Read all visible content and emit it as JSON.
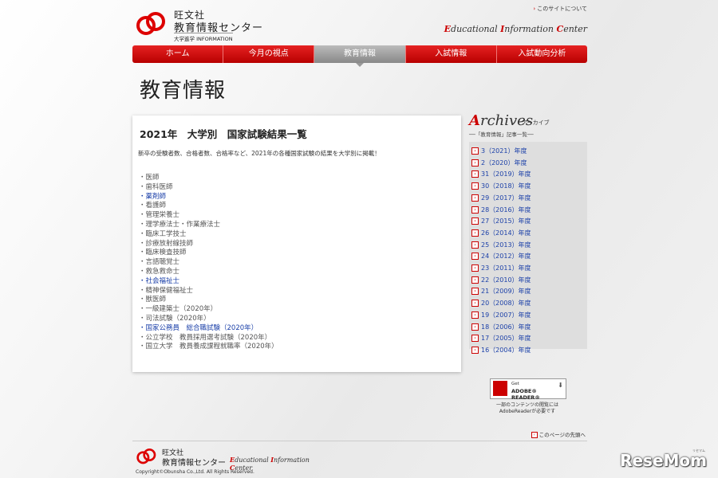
{
  "header": {
    "logo_line1": "旺文社",
    "logo_line2": "教育情報センター",
    "logo_line3": "大学進学 INFORMATION",
    "about_link": "このサイトについて",
    "eic_E": "E",
    "eic_ducational": "ducational ",
    "eic_I": "I",
    "eic_nformation": "nformation ",
    "eic_C": "C",
    "eic_enter": "enter"
  },
  "nav": [
    {
      "label": "ホーム"
    },
    {
      "label": "今月の視点"
    },
    {
      "label": "教育情報"
    },
    {
      "label": "入試情報"
    },
    {
      "label": "入試動向分析"
    }
  ],
  "page_title": "教育情報",
  "article": {
    "title": "2021年　大学別　国家試験結果一覧",
    "desc": "新卒の受験者数、合格者数、合格率など、2021年の各種国家試験の結果を大学別に掲載！",
    "items": [
      {
        "label": "・医師",
        "link": false
      },
      {
        "label": "・歯科医師",
        "link": false
      },
      {
        "label": "・薬剤師",
        "link": true
      },
      {
        "label": "・看護師",
        "link": false
      },
      {
        "label": "・管理栄養士",
        "link": false
      },
      {
        "label": "・理学療法士・作業療法士",
        "link": false
      },
      {
        "label": "・臨床工学技士",
        "link": false
      },
      {
        "label": "・診療放射線技師",
        "link": false
      },
      {
        "label": "・臨床検査技師",
        "link": false
      },
      {
        "label": "・言語聴覚士",
        "link": false
      },
      {
        "label": "・救急救命士",
        "link": false
      },
      {
        "label": "・社会福祉士",
        "link": true
      },
      {
        "label": "・精神保健福祉士",
        "link": false
      },
      {
        "label": "・獣医師",
        "link": false
      },
      {
        "label": "・一級建築士（2020年）",
        "link": false
      },
      {
        "label": "・司法試験（2020年）",
        "link": false
      },
      {
        "label": "・国家公務員　総合職試験（2020年）",
        "link": true
      },
      {
        "label": "・公立学校　教員採用選考試験（2020年）",
        "link": false
      },
      {
        "label": "・国立大学　教員養成課程就職率（2020年）",
        "link": false
      }
    ]
  },
  "archives": {
    "title_A": "A",
    "title_rest": "rchives",
    "title_jp": "アーカイブ",
    "subtitle": "──「教育情報」記事一覧──",
    "years": [
      "3（2021）年度",
      "2（2020）年度",
      "31（2019）年度",
      "30（2018）年度",
      "29（2017）年度",
      "28（2016）年度",
      "27（2015）年度",
      "26（2014）年度",
      "25（2013）年度",
      "24（2012）年度",
      "23（2011）年度",
      "22（2010）年度",
      "21（2009）年度",
      "20（2008）年度",
      "19（2007）年度",
      "18（2006）年度",
      "17（2005）年度",
      "16（2004）年度"
    ]
  },
  "adobe": {
    "get": "Get",
    "reader": "ADOBE® READER®",
    "note1": "一部のコンテンツの閲覧には",
    "note2": "AdobeReaderが必要です"
  },
  "pagetop": "このページの先頭へ",
  "footer": {
    "line1": "旺文社",
    "line2": "教育情報センター",
    "eic_E": "E",
    "eic_ducational": "ducational ",
    "eic_I": "I",
    "eic_nformation": "nformation ",
    "eic_C": "C",
    "eic_enter": "enter",
    "copyright": "Copyright©Obunsha Co.,Ltd. All Rights Reserved."
  },
  "watermark": {
    "text": "ReseMom",
    "small": "リセマム"
  },
  "colors": {
    "accent": "#cc0000",
    "link": "#1a3fa8"
  }
}
